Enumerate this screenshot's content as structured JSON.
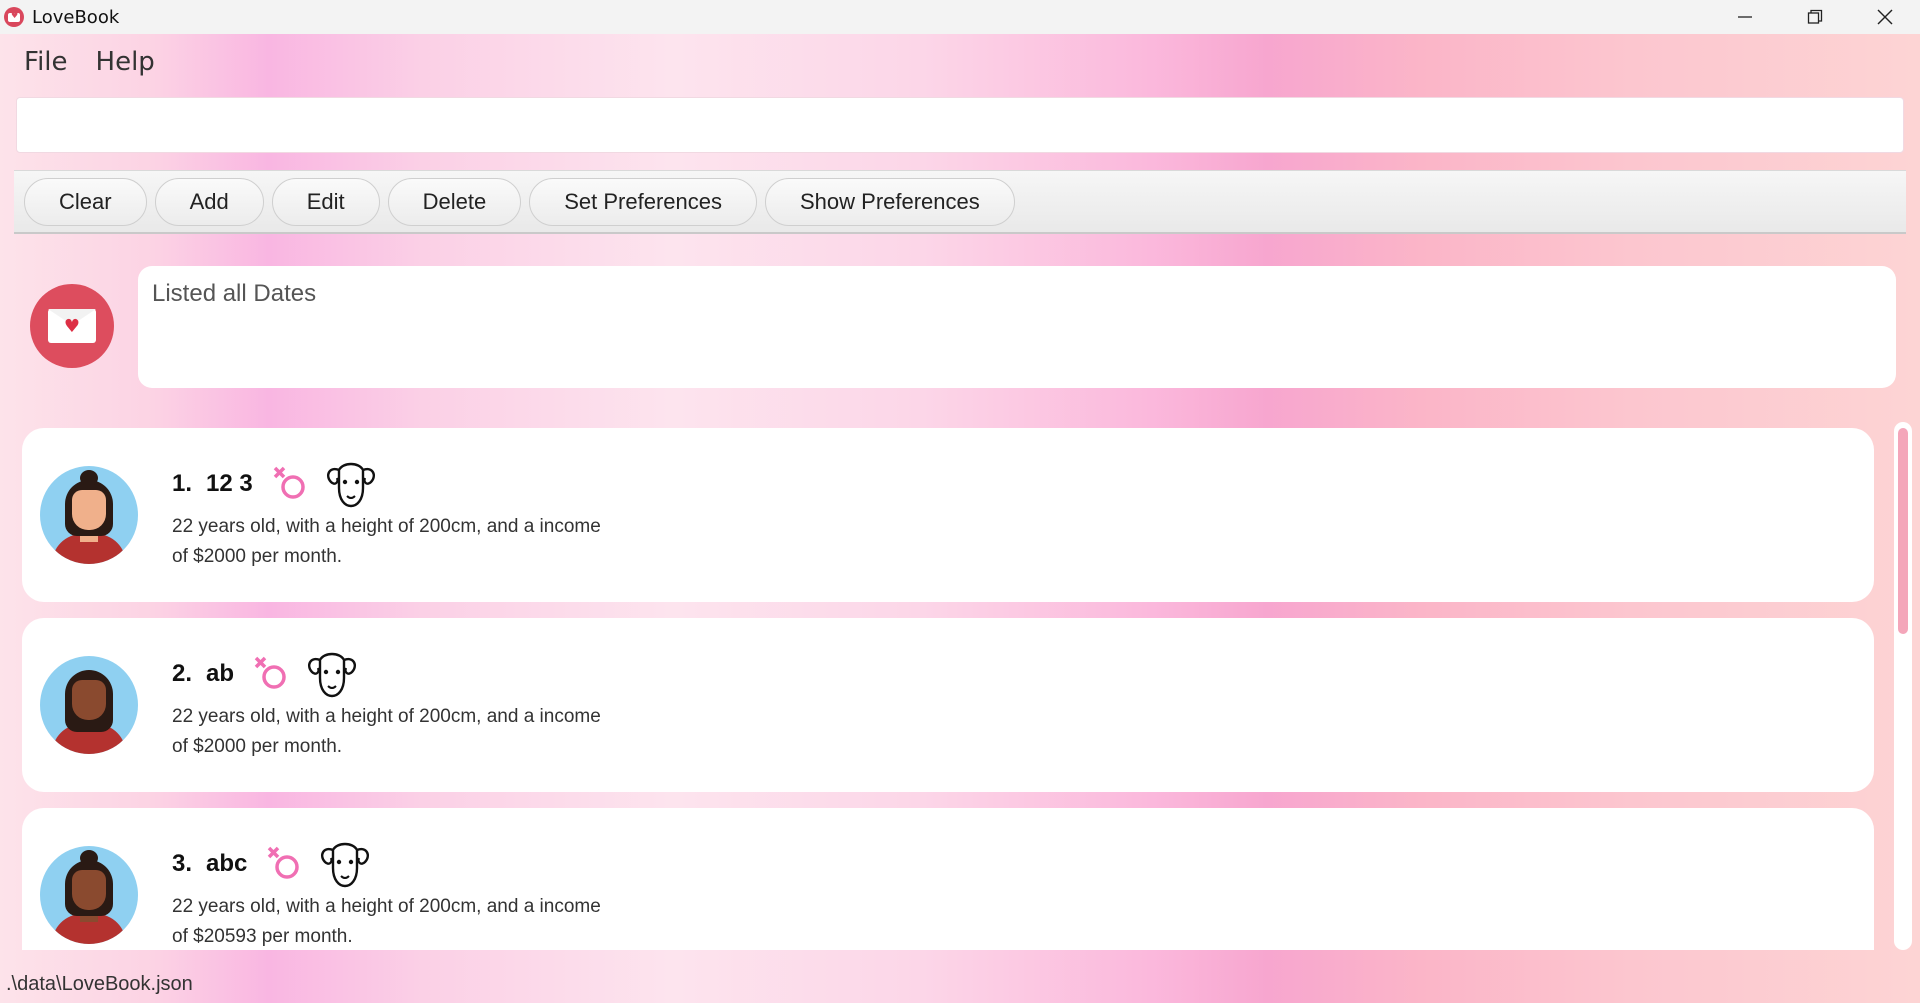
{
  "window": {
    "title": "LoveBook",
    "controls": [
      "minimize",
      "restore",
      "close"
    ]
  },
  "menu": {
    "items": [
      "File",
      "Help"
    ]
  },
  "command_box": {
    "value": "",
    "placeholder": ""
  },
  "toolbar": {
    "buttons": [
      "Clear",
      "Add",
      "Edit",
      "Delete",
      "Set Preferences",
      "Show Preferences"
    ]
  },
  "result": {
    "message": "Listed all Dates",
    "icon": "envelope-heart-icon"
  },
  "dates": [
    {
      "index": "1.",
      "name": "12 3",
      "gender_icon": "female-symbol-icon",
      "zodiac_icon": "aries-ram-icon",
      "desc_line1": "22 years old, with a height of 200cm, and a income",
      "desc_line2": "of $2000 per month."
    },
    {
      "index": "2.",
      "name": "ab",
      "gender_icon": "female-symbol-icon",
      "zodiac_icon": "aries-ram-icon",
      "desc_line1": "22 years old, with a height of 200cm, and a income",
      "desc_line2": "of $2000 per month."
    },
    {
      "index": "3.",
      "name": "abc",
      "gender_icon": "female-symbol-icon",
      "zodiac_icon": "aries-ram-icon",
      "desc_line1": "22 years old, with a height of 200cm, and a income",
      "desc_line2": "of $20593 per month."
    }
  ],
  "status": {
    "path": ".\\data\\LoveBook.json"
  },
  "colors": {
    "accent": "#dd4d5e",
    "pink_icon": "#f06fb3",
    "scroll_thumb": "#f4a6ba"
  }
}
